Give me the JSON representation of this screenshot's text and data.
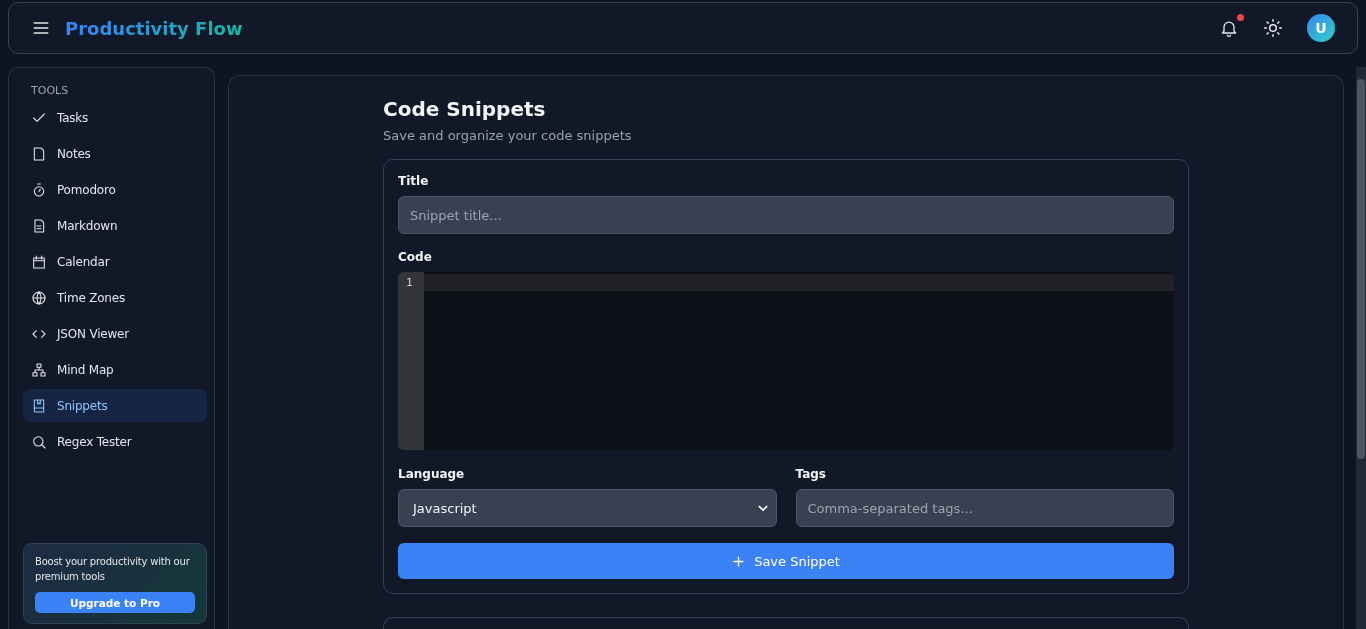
{
  "header": {
    "title": "Productivity Flow",
    "notification_unread": true,
    "avatar": "U"
  },
  "sidebar": {
    "section": "TOOLS",
    "items": [
      {
        "label": "Tasks",
        "kind": "check",
        "selected": false
      },
      {
        "label": "Notes",
        "kind": "note",
        "selected": false
      },
      {
        "label": "Pomodoro",
        "kind": "timer",
        "selected": false
      },
      {
        "label": "Markdown",
        "kind": "doc",
        "selected": false
      },
      {
        "label": "Calendar",
        "kind": "calendar",
        "selected": false
      },
      {
        "label": "Time Zones",
        "kind": "globe",
        "selected": false
      },
      {
        "label": "JSON Viewer",
        "kind": "code",
        "selected": false
      },
      {
        "label": "Mind Map",
        "kind": "tree",
        "selected": false
      },
      {
        "label": "Snippets",
        "kind": "book",
        "selected": true
      },
      {
        "label": "Regex Tester",
        "kind": "search",
        "selected": false
      }
    ],
    "promo": {
      "text": "Boost your productivity with our premium tools",
      "button": "Upgrade to Pro"
    }
  },
  "page": {
    "title": "Code Snippets",
    "subtitle": "Save and organize your code snippets"
  },
  "form": {
    "title_label": "Title",
    "title_placeholder": "Snippet title...",
    "code_label": "Code",
    "line_numbers": [
      "1"
    ],
    "language_label": "Language",
    "language_value": "Javascript",
    "tags_label": "Tags",
    "tags_placeholder": "Comma-separated tags...",
    "save_button": "Save Snippet"
  }
}
